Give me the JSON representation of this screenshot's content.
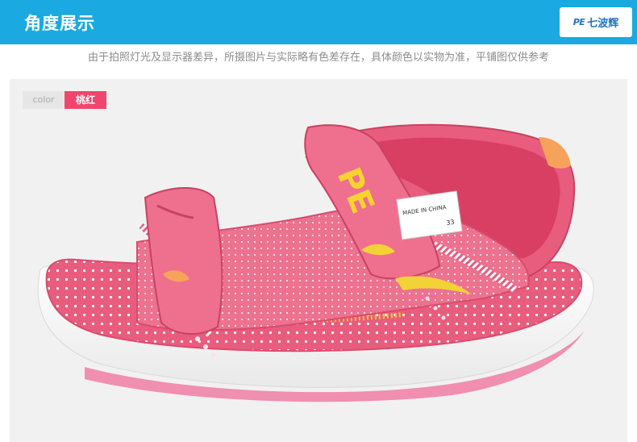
{
  "header": {
    "title": "角度展示",
    "logo_mark": "PE",
    "logo_text": "七波辉"
  },
  "notice": "由于拍照灯光及显示器差异，所摄图片与实际略有色差存在，具体颜色以实物为准，平铺图仅供参考",
  "color_tag": {
    "label": "color",
    "value": "桃红"
  },
  "product": {
    "brand_print": "PE",
    "made_in": "MADE IN CHINA",
    "size_label": "33"
  },
  "colors": {
    "header": "#1aa9e1",
    "accent": "#f0466e",
    "shoe_pink": "#e85c7d",
    "shoe_light": "#f39ab1"
  }
}
